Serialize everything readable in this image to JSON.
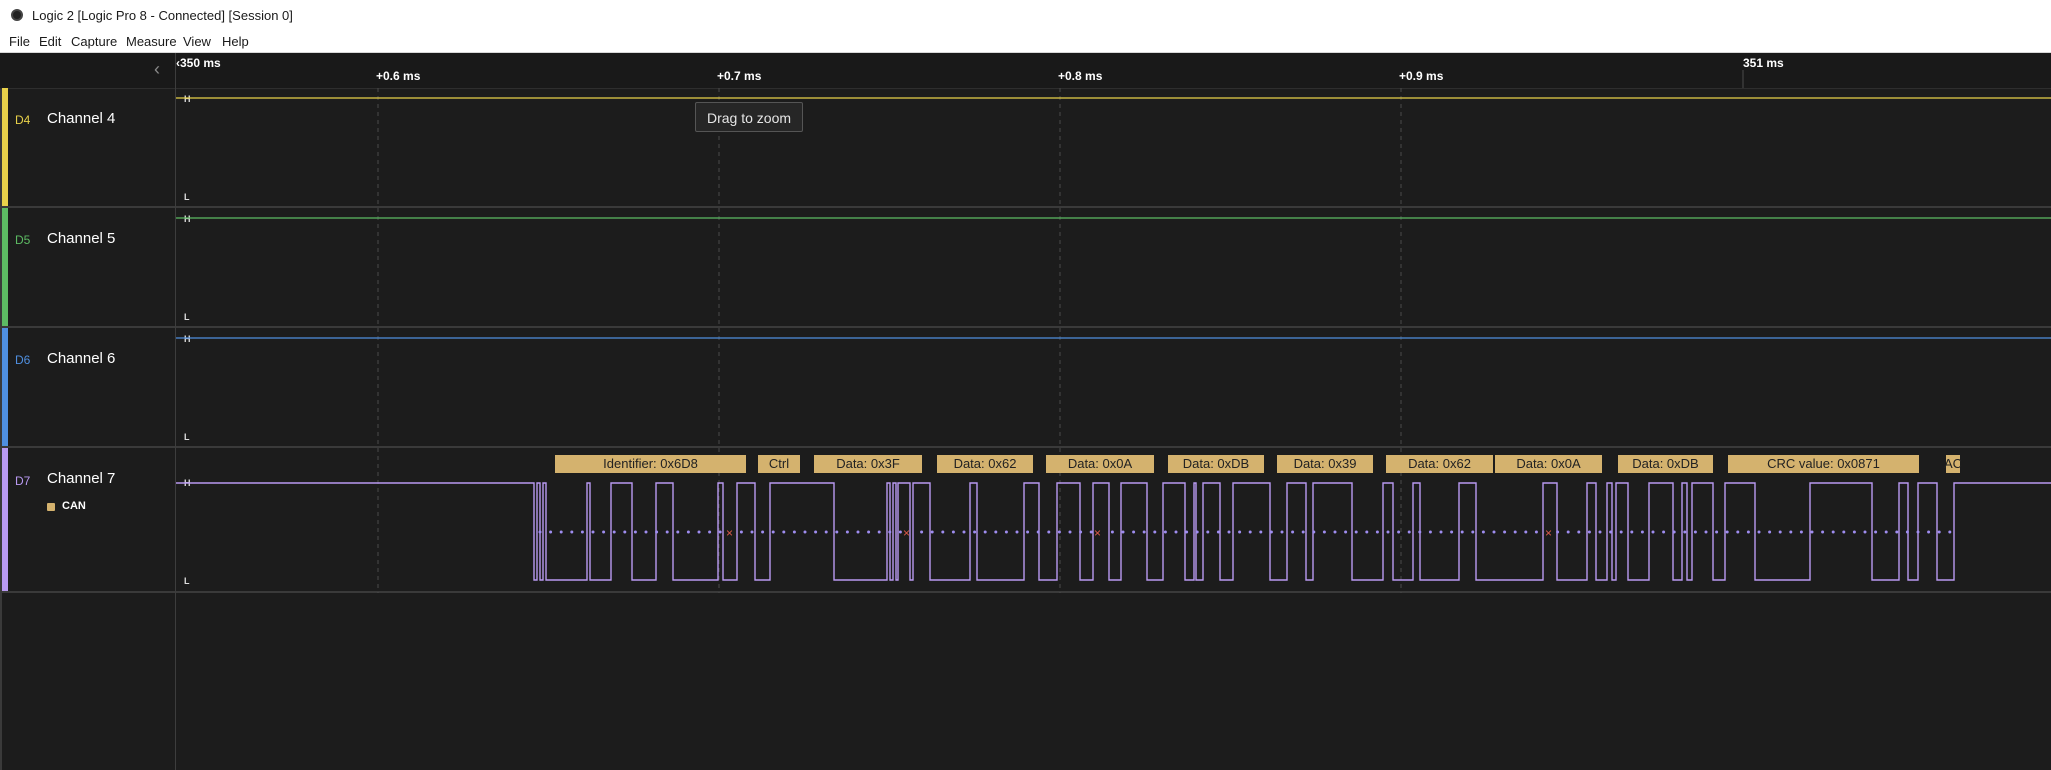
{
  "window": {
    "title": "Logic 2 [Logic Pro 8 - Connected] [Session 0]"
  },
  "menu": {
    "items": [
      "File",
      "Edit",
      "Capture",
      "Measure",
      "View",
      "Help"
    ]
  },
  "timeline": {
    "origin_label": "350 ms",
    "ticks": [
      "+0.6 ms",
      "+0.7 ms",
      "+0.8 ms",
      "+0.9 ms",
      "351 ms"
    ]
  },
  "channels": [
    {
      "id": "D4",
      "name": "Channel 4",
      "color": "#e8d14a",
      "level": "H"
    },
    {
      "id": "D5",
      "name": "Channel 5",
      "color": "#5dbb63",
      "level": "H"
    },
    {
      "id": "D6",
      "name": "Channel 6",
      "color": "#4f8fe0",
      "level": "H"
    },
    {
      "id": "D7",
      "name": "Channel 7",
      "color": "#b99af2",
      "analyzer": "CAN"
    }
  ],
  "level_labels": {
    "high": "H",
    "low": "L"
  },
  "tooltip": "Drag to zoom",
  "can_frames": [
    "Identifier: 0x6D8",
    "Ctrl",
    "Data: 0x3F",
    "Data: 0x62",
    "Data: 0x0A",
    "Data: 0xDB",
    "Data: 0x39",
    "Data: 0x62",
    "Data: 0x0A",
    "Data: 0xDB",
    "CRC value: 0x0871",
    "AC"
  ],
  "colors": {
    "annotation_bg": "#d4b26e",
    "annotation_text": "#222222",
    "stuff_bit_error": "#e05a4a"
  }
}
